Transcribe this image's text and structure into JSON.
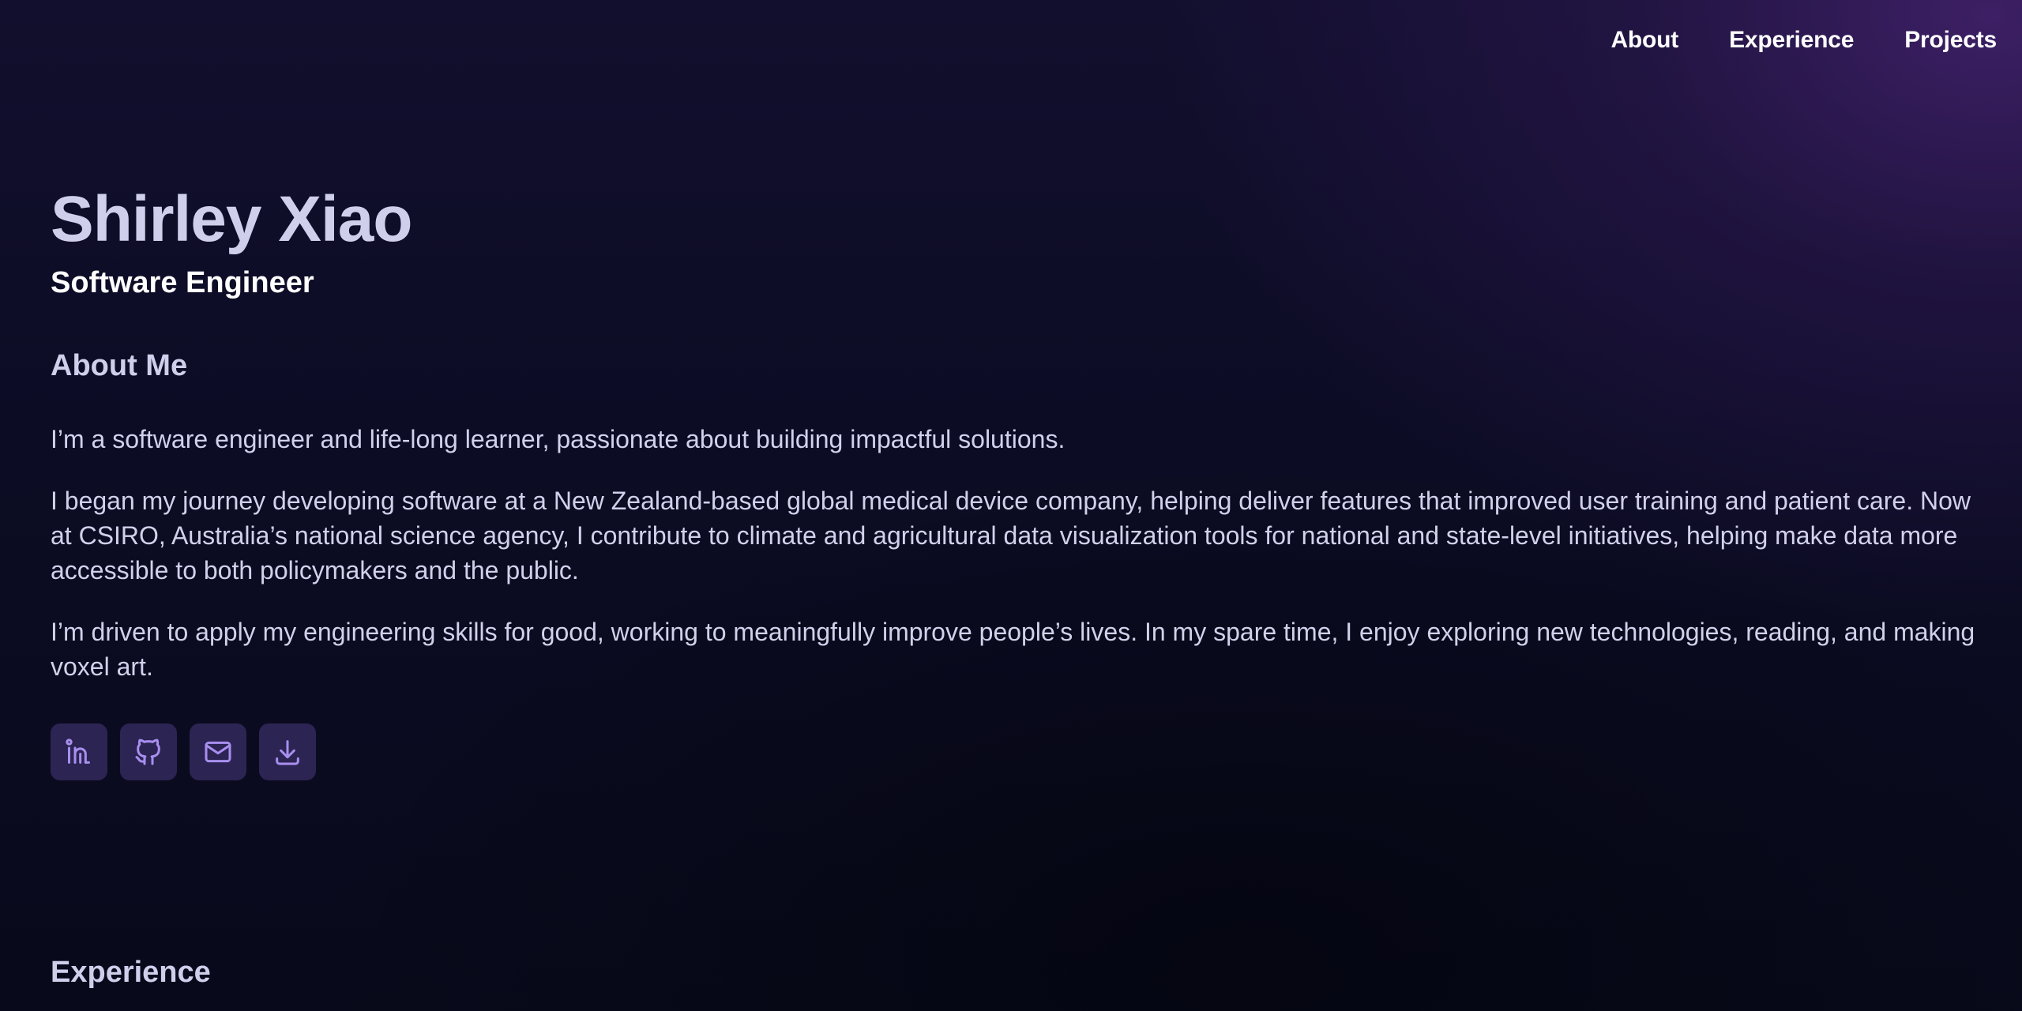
{
  "nav": {
    "items": [
      {
        "label": "About"
      },
      {
        "label": "Experience"
      },
      {
        "label": "Projects"
      }
    ]
  },
  "hero": {
    "name": "Shirley Xiao",
    "role": "Software Engineer"
  },
  "about": {
    "heading": "About Me",
    "paragraphs": [
      "I’m a software engineer and life-long learner, passionate about building impactful solutions.",
      "I began my journey developing software at a New Zealand-based global medical device company, helping deliver features that improved user training and patient care. Now at CSIRO, Australia’s national science agency, I contribute to climate and agricultural data visualization tools for national and state-level initiatives, helping make data more accessible to both policymakers and the public.",
      "I’m driven to apply my engineering skills for good, working to meaningfully improve people’s lives. In my spare time, I enjoy exploring new technologies, reading, and making voxel art."
    ]
  },
  "socials": {
    "items": [
      {
        "icon": "linkedin-icon"
      },
      {
        "icon": "github-icon"
      },
      {
        "icon": "mail-icon"
      },
      {
        "icon": "download-icon"
      }
    ]
  },
  "experience": {
    "heading": "Experience"
  },
  "colors": {
    "background_top": "#120f2e",
    "background_glow": "#44226e",
    "heading_text": "#cfcfec",
    "body_text": "#d2d1ec",
    "icon_button_bg": "#2c2452",
    "icon_stroke": "#a88ff0"
  }
}
